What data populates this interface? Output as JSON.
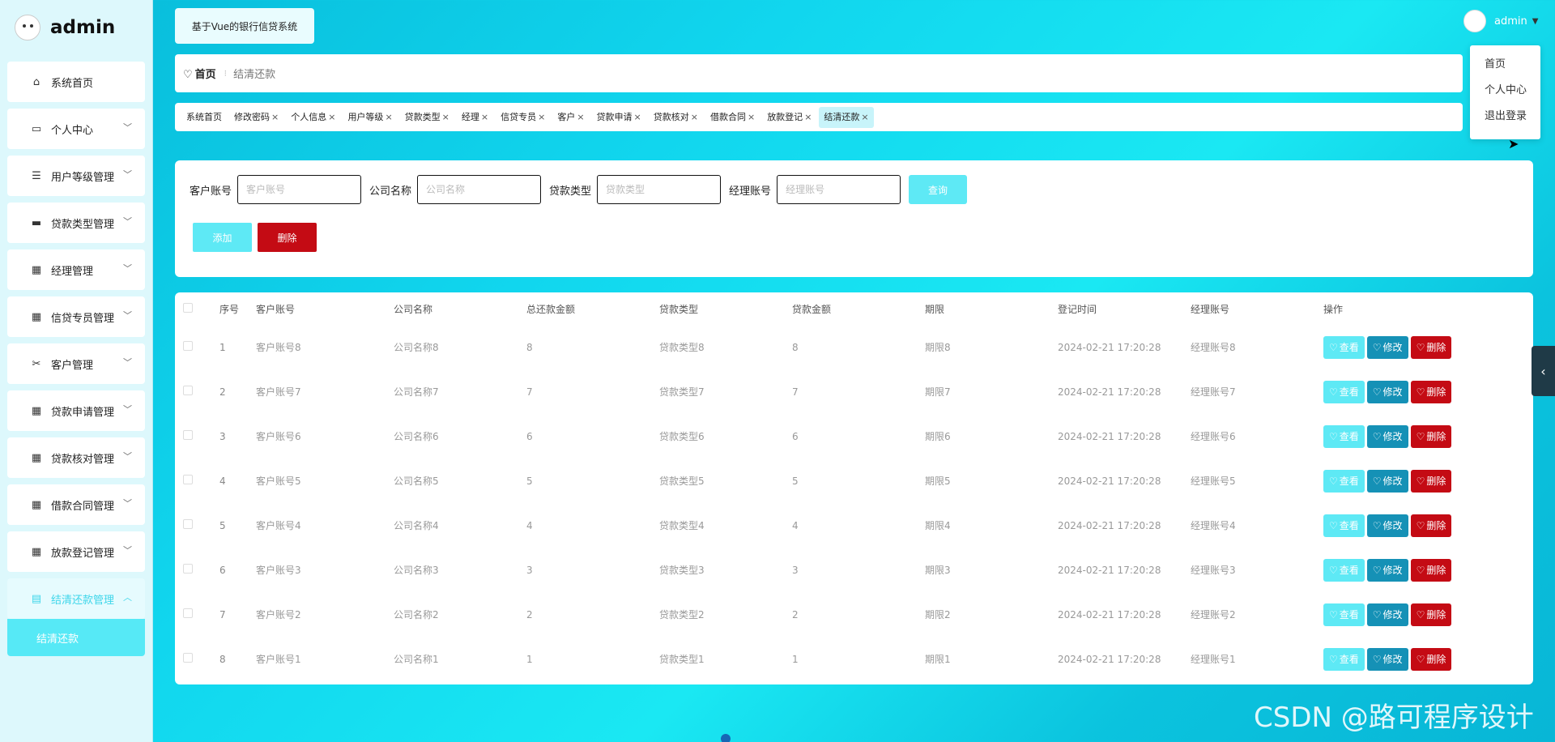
{
  "brand": {
    "name": "admin"
  },
  "sidebar": {
    "items": [
      {
        "label": "系统首页",
        "icon": "home-icon",
        "glyph": "⌂",
        "has_chevron": false
      },
      {
        "label": "个人中心",
        "icon": "card-icon",
        "glyph": "▭",
        "has_chevron": true
      },
      {
        "label": "用户等级管理",
        "icon": "list-icon",
        "glyph": "☰",
        "has_chevron": true
      },
      {
        "label": "贷款类型管理",
        "icon": "printer-icon",
        "glyph": "▬",
        "has_chevron": true
      },
      {
        "label": "经理管理",
        "icon": "grid-icon",
        "glyph": "▦",
        "has_chevron": true
      },
      {
        "label": "信贷专员管理",
        "icon": "grid-icon",
        "glyph": "▦",
        "has_chevron": true
      },
      {
        "label": "客户管理",
        "icon": "ticket-icon",
        "glyph": "✂",
        "has_chevron": true
      },
      {
        "label": "贷款申请管理",
        "icon": "grid-icon",
        "glyph": "▦",
        "has_chevron": true
      },
      {
        "label": "贷款核对管理",
        "icon": "grid-icon",
        "glyph": "▦",
        "has_chevron": true
      },
      {
        "label": "借款合同管理",
        "icon": "grid-icon",
        "glyph": "▦",
        "has_chevron": true
      },
      {
        "label": "放款登记管理",
        "icon": "grid-icon",
        "glyph": "▦",
        "has_chevron": true
      },
      {
        "label": "结清还款管理",
        "icon": "clipboard-icon",
        "glyph": "▤",
        "has_chevron": true,
        "active": true
      }
    ],
    "submenu": {
      "label": "结清还款"
    }
  },
  "header": {
    "system_title": "基于Vue的银行信贷系统",
    "user_name": "admin",
    "caret": "▼"
  },
  "dropdown": {
    "items": [
      "首页",
      "个人中心",
      "退出登录"
    ]
  },
  "breadcrumb": {
    "home": "首页",
    "separator": "⁝",
    "current": "结清还款"
  },
  "tags": [
    {
      "label": "系统首页",
      "closable": false
    },
    {
      "label": "修改密码",
      "closable": true
    },
    {
      "label": "个人信息",
      "closable": true
    },
    {
      "label": "用户等级",
      "closable": true
    },
    {
      "label": "贷款类型",
      "closable": true
    },
    {
      "label": "经理",
      "closable": true
    },
    {
      "label": "信贷专员",
      "closable": true
    },
    {
      "label": "客户",
      "closable": true
    },
    {
      "label": "贷款申请",
      "closable": true
    },
    {
      "label": "贷款核对",
      "closable": true
    },
    {
      "label": "借款合同",
      "closable": true
    },
    {
      "label": "放款登记",
      "closable": true
    },
    {
      "label": "结清还款",
      "closable": true,
      "active": true
    }
  ],
  "search": {
    "fields": [
      {
        "label": "客户账号",
        "placeholder": "客户账号",
        "value": ""
      },
      {
        "label": "公司名称",
        "placeholder": "公司名称",
        "value": ""
      },
      {
        "label": "贷款类型",
        "placeholder": "贷款类型",
        "value": ""
      },
      {
        "label": "经理账号",
        "placeholder": "经理账号",
        "value": ""
      }
    ],
    "query_label": "查询"
  },
  "actions": {
    "add_label": "添加",
    "delete_label": "删除"
  },
  "table": {
    "columns": [
      "序号",
      "客户账号",
      "公司名称",
      "总还款金额",
      "贷款类型",
      "贷款金额",
      "期限",
      "登记时间",
      "经理账号",
      "操作"
    ],
    "rows": [
      [
        "1",
        "客户账号8",
        "公司名称8",
        "8",
        "贷款类型8",
        "8",
        "期限8",
        "2024-02-21 17:20:28",
        "经理账号8"
      ],
      [
        "2",
        "客户账号7",
        "公司名称7",
        "7",
        "贷款类型7",
        "7",
        "期限7",
        "2024-02-21 17:20:28",
        "经理账号7"
      ],
      [
        "3",
        "客户账号6",
        "公司名称6",
        "6",
        "贷款类型6",
        "6",
        "期限6",
        "2024-02-21 17:20:28",
        "经理账号6"
      ],
      [
        "4",
        "客户账号5",
        "公司名称5",
        "5",
        "贷款类型5",
        "5",
        "期限5",
        "2024-02-21 17:20:28",
        "经理账号5"
      ],
      [
        "5",
        "客户账号4",
        "公司名称4",
        "4",
        "贷款类型4",
        "4",
        "期限4",
        "2024-02-21 17:20:28",
        "经理账号4"
      ],
      [
        "6",
        "客户账号3",
        "公司名称3",
        "3",
        "贷款类型3",
        "3",
        "期限3",
        "2024-02-21 17:20:28",
        "经理账号3"
      ],
      [
        "7",
        "客户账号2",
        "公司名称2",
        "2",
        "贷款类型2",
        "2",
        "期限2",
        "2024-02-21 17:20:28",
        "经理账号2"
      ],
      [
        "8",
        "客户账号1",
        "公司名称1",
        "1",
        "贷款类型1",
        "1",
        "期限1",
        "2024-02-21 17:20:28",
        "经理账号1"
      ]
    ],
    "op_labels": {
      "view": "查看",
      "edit": "修改",
      "delete": "删除"
    },
    "op_icon": "♡"
  },
  "side_toggle": {
    "glyph": "‹"
  },
  "watermark": "CSDN @路可程序设计",
  "colors": {
    "accent": "#5ee9f5",
    "edit": "#1591b6",
    "danger": "#c40b14"
  }
}
